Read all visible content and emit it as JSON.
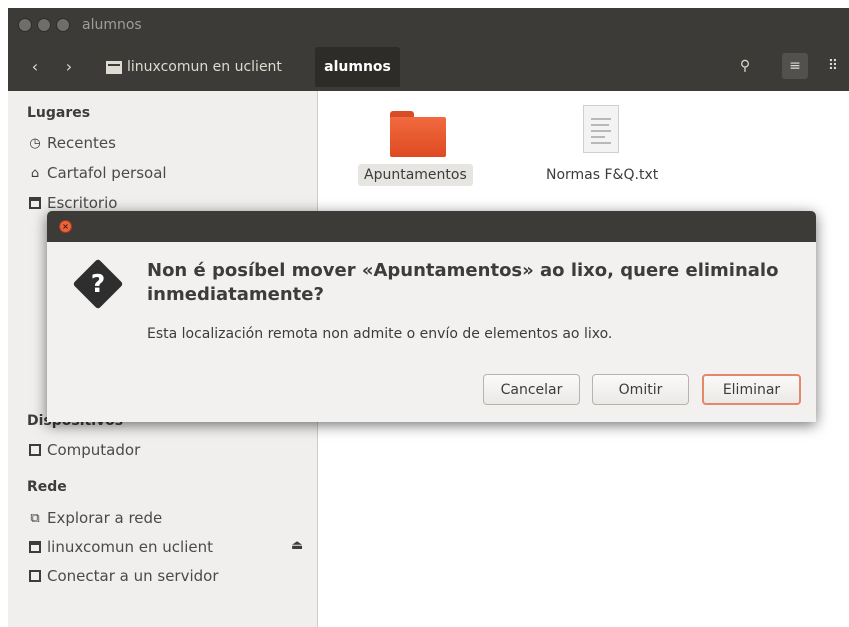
{
  "window": {
    "title": "alumnos"
  },
  "toolbar": {
    "back": "‹",
    "forward": "›",
    "crumbs": [
      "linuxcomun en uclient",
      "alumnos"
    ],
    "search_icon": "⚲",
    "list_icon": "≡",
    "grid_icon": "⠿"
  },
  "sidebar": {
    "sections": [
      {
        "heading": "Lugares",
        "items": [
          {
            "icon": "clock-icon",
            "label": "Recentes"
          },
          {
            "icon": "home-icon",
            "label": "Cartafol persoal"
          },
          {
            "icon": "folder-icon",
            "label": "Escritorio"
          }
        ]
      },
      {
        "heading": "Dispositivos",
        "items": [
          {
            "icon": "computer-icon",
            "label": "Computador"
          }
        ]
      },
      {
        "heading": "Rede",
        "items": [
          {
            "icon": "network-icon",
            "label": "Explorar a rede"
          },
          {
            "icon": "server-icon",
            "label": "linuxcomun en uclient"
          },
          {
            "icon": "connect-icon",
            "label": "Conectar a un servidor"
          }
        ]
      }
    ]
  },
  "content": {
    "files": [
      {
        "name": "Apuntamentos",
        "type": "folder",
        "selected": true
      },
      {
        "name": "Normas F&Q.txt",
        "type": "text-file",
        "selected": false
      }
    ]
  },
  "dialog": {
    "heading": "Non é posíbel mover «Apuntamentos» ao lixo, quere eliminalo inmediatamente?",
    "body": "Esta localización remota non admite o envío de elementos ao lixo.",
    "buttons": {
      "cancel": "Cancelar",
      "skip": "Omitir",
      "delete": "Eliminar"
    }
  },
  "colors": {
    "titlebar": "#3c3b37",
    "accent": "#e9643b",
    "folder": "#f26a3f"
  }
}
